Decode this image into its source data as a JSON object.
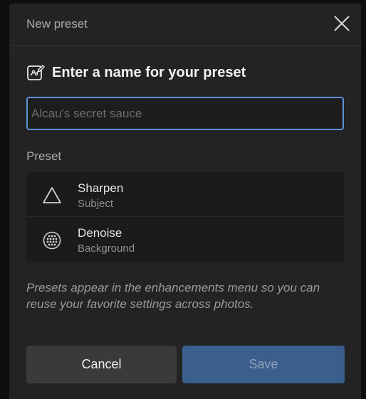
{
  "dialog": {
    "title": "New preset",
    "close_icon": "close-icon"
  },
  "name_section": {
    "icon": "preset-edit-icon",
    "heading": "Enter a name for your preset",
    "input_value": "",
    "input_placeholder": "Alcau's secret sauce"
  },
  "preset_section": {
    "label": "Preset",
    "items": [
      {
        "name": "Sharpen",
        "target": "Subject",
        "icon": "triangle-icon"
      },
      {
        "name": "Denoise",
        "target": "Background",
        "icon": "grid-dots-icon"
      }
    ]
  },
  "hint": "Presets appear in the enhancements menu so you can reuse your favorite settings across photos.",
  "buttons": {
    "cancel": "Cancel",
    "save": "Save"
  },
  "colors": {
    "accent": "#5b93d6",
    "save_bg": "#3a5f8c",
    "dialog_bg": "#232323"
  }
}
